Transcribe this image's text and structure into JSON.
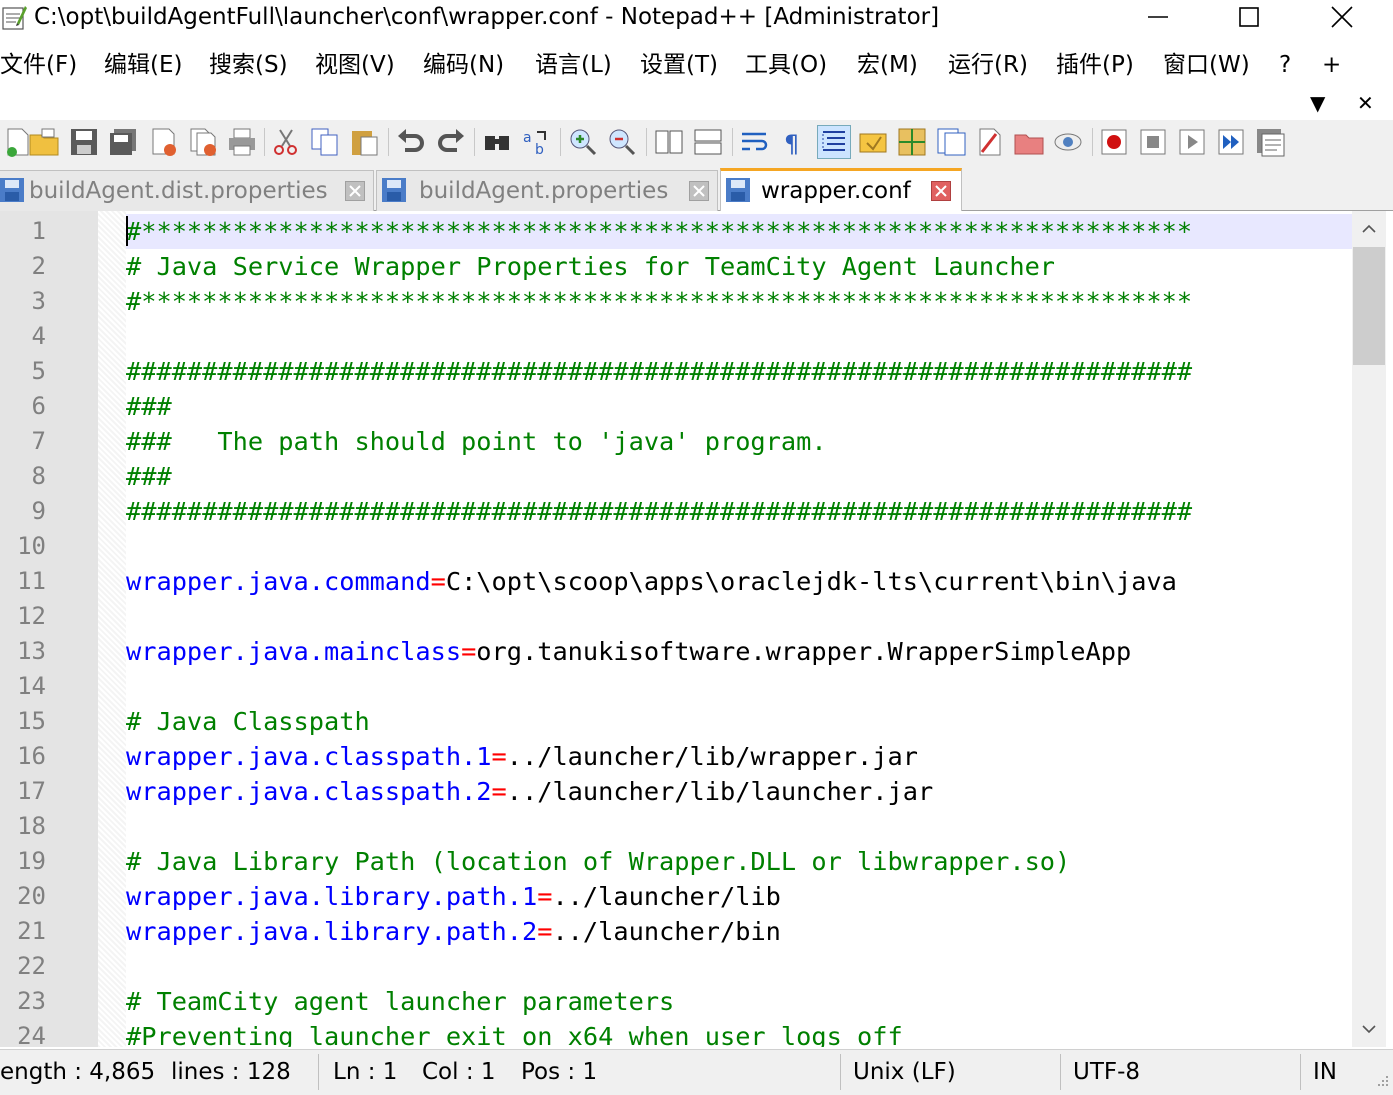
{
  "window": {
    "title": "C:\\opt\\buildAgentFull\\launcher\\conf\\wrapper.conf - Notepad++ [Administrator]"
  },
  "menu": {
    "items": [
      "文件(F)",
      "编辑(E)",
      "搜索(S)",
      "视图(V)",
      "编码(N)",
      "语言(L)",
      "设置(T)",
      "工具(O)",
      "宏(M)",
      "运行(R)",
      "插件(P)",
      "窗口(W)",
      "?",
      "+"
    ],
    "row2": [
      "▼",
      "✕"
    ]
  },
  "toolbar": {
    "icons": [
      "new-file-icon",
      "open-folder-icon",
      "save-icon",
      "save-all-icon",
      "close-icon",
      "close-all-icon",
      "print-icon",
      "cut-icon",
      "copy-icon",
      "paste-icon",
      "undo-icon",
      "redo-icon",
      "find-icon",
      "replace-icon",
      "zoom-in-icon",
      "zoom-out-icon",
      "sync-vertical-icon",
      "sync-horizontal-icon",
      "word-wrap-icon",
      "show-all-characters-icon",
      "indent-guide-icon",
      "user-defined-language-icon",
      "document-map-icon",
      "function-list-icon",
      "folder-as-workspace-icon",
      "monitoring-icon",
      "record-macro-icon",
      "stop-recording-icon",
      "playback-macro-icon",
      "run-macro-multiple-icon",
      "save-macro-icon"
    ]
  },
  "tabs": [
    {
      "label": "buildAgent.dist.properties",
      "active": false
    },
    {
      "label": "buildAgent.properties",
      "active": false
    },
    {
      "label": "wrapper.conf",
      "active": true
    }
  ],
  "editor": {
    "lines": [
      {
        "n": "1",
        "parts": [
          {
            "t": "#*********************************************************************",
            "c": "comment"
          }
        ]
      },
      {
        "n": "2",
        "parts": [
          {
            "t": "# Java Service Wrapper Properties for TeamCity Agent Launcher",
            "c": "comment"
          }
        ]
      },
      {
        "n": "3",
        "parts": [
          {
            "t": "#*********************************************************************",
            "c": "comment"
          }
        ]
      },
      {
        "n": "4",
        "parts": []
      },
      {
        "n": "5",
        "parts": [
          {
            "t": "######################################################################",
            "c": "comment"
          }
        ]
      },
      {
        "n": "6",
        "parts": [
          {
            "t": "###",
            "c": "comment"
          }
        ]
      },
      {
        "n": "7",
        "parts": [
          {
            "t": "###   The path should point to 'java' program.",
            "c": "comment"
          }
        ]
      },
      {
        "n": "8",
        "parts": [
          {
            "t": "###",
            "c": "comment"
          }
        ]
      },
      {
        "n": "9",
        "parts": [
          {
            "t": "######################################################################",
            "c": "comment"
          }
        ]
      },
      {
        "n": "10",
        "parts": []
      },
      {
        "n": "11",
        "parts": [
          {
            "t": "wrapper.java.command",
            "c": "key"
          },
          {
            "t": "=",
            "c": "eq"
          },
          {
            "t": "C:\\opt\\scoop\\apps\\oraclejdk-lts\\current\\bin\\java",
            "c": "val"
          }
        ]
      },
      {
        "n": "12",
        "parts": []
      },
      {
        "n": "13",
        "parts": [
          {
            "t": "wrapper.java.mainclass",
            "c": "key"
          },
          {
            "t": "=",
            "c": "eq"
          },
          {
            "t": "org.tanukisoftware.wrapper.WrapperSimpleApp",
            "c": "val"
          }
        ]
      },
      {
        "n": "14",
        "parts": []
      },
      {
        "n": "15",
        "parts": [
          {
            "t": "# Java Classpath",
            "c": "comment"
          }
        ]
      },
      {
        "n": "16",
        "parts": [
          {
            "t": "wrapper.java.classpath.1",
            "c": "key"
          },
          {
            "t": "=",
            "c": "eq"
          },
          {
            "t": "../launcher/lib/wrapper.jar",
            "c": "val"
          }
        ]
      },
      {
        "n": "17",
        "parts": [
          {
            "t": "wrapper.java.classpath.2",
            "c": "key"
          },
          {
            "t": "=",
            "c": "eq"
          },
          {
            "t": "../launcher/lib/launcher.jar",
            "c": "val"
          }
        ]
      },
      {
        "n": "18",
        "parts": []
      },
      {
        "n": "19",
        "parts": [
          {
            "t": "# Java Library Path (location of Wrapper.DLL or libwrapper.so)",
            "c": "comment"
          }
        ]
      },
      {
        "n": "20",
        "parts": [
          {
            "t": "wrapper.java.library.path.1",
            "c": "key"
          },
          {
            "t": "=",
            "c": "eq"
          },
          {
            "t": "../launcher/lib",
            "c": "val"
          }
        ]
      },
      {
        "n": "21",
        "parts": [
          {
            "t": "wrapper.java.library.path.2",
            "c": "key"
          },
          {
            "t": "=",
            "c": "eq"
          },
          {
            "t": "../launcher/bin",
            "c": "val"
          }
        ]
      },
      {
        "n": "22",
        "parts": []
      },
      {
        "n": "23",
        "parts": [
          {
            "t": "# TeamCity agent launcher parameters",
            "c": "comment"
          }
        ]
      },
      {
        "n": "24",
        "parts": [
          {
            "t": "#Preventing launcher exit on x64 when user logs off",
            "c": "comment"
          }
        ]
      }
    ]
  },
  "status": {
    "length": "ength : 4,865",
    "lines": "lines : 128",
    "ln": "Ln : 1",
    "col": "Col : 1",
    "pos": "Pos : 1",
    "eol": "Unix (LF)",
    "encoding": "UTF-8",
    "mode": "IN"
  },
  "colors": {
    "comment": "#008000",
    "key": "#0000ff",
    "operator": "#ff0000",
    "value": "#000000",
    "line_number": "#808080",
    "current_line": "#e8e8ff",
    "active_tab_accent": "#f5a623"
  }
}
